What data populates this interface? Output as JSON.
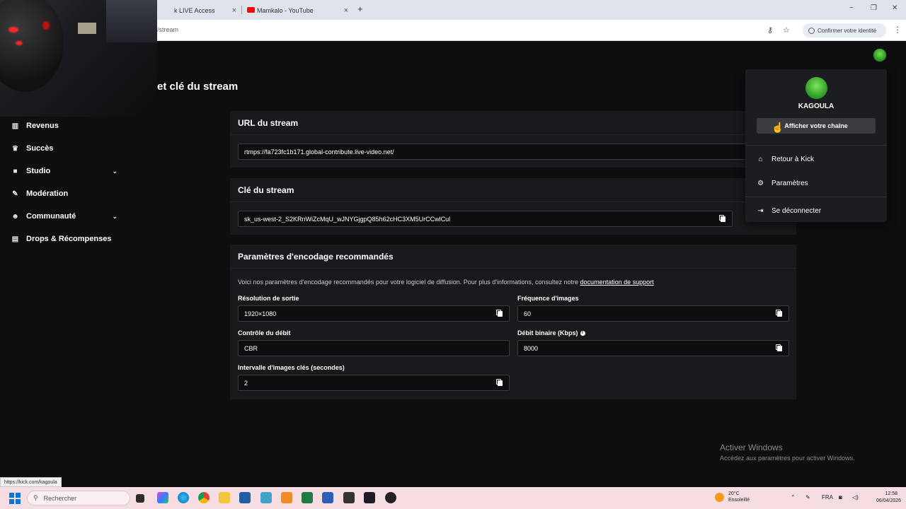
{
  "browser": {
    "tabs": [
      {
        "title": "k LIVE Access",
        "close": "×"
      },
      {
        "title": "Mamkalo - YouTube",
        "close": "×"
      }
    ],
    "new_tab": "+",
    "url": "/stream",
    "confirm_identity": "Confirmer votre identité",
    "window_min": "−",
    "window_max": "❐",
    "window_close": "✕"
  },
  "sidebar": {
    "items": [
      {
        "label": "Revenus",
        "icon": "bar-chart-icon",
        "glyph": "▥"
      },
      {
        "label": "Succès",
        "icon": "trophy-icon",
        "glyph": "🏆"
      },
      {
        "label": "Studio",
        "icon": "video-icon",
        "glyph": "■",
        "chevron": "⌄"
      },
      {
        "label": "Modération",
        "icon": "wrench-icon",
        "glyph": "🔧"
      },
      {
        "label": "Communauté",
        "icon": "users-icon",
        "glyph": "👥",
        "chevron": "⌄"
      },
      {
        "label": "Drops & Récompenses",
        "icon": "gift-icon",
        "glyph": "▤"
      }
    ]
  },
  "page": {
    "title": "et clé du stream"
  },
  "stream_url": {
    "heading": "URL du stream",
    "value": "rtmps://fa723fc1b171.global-contribute.live-video.net/"
  },
  "stream_key": {
    "heading": "Clé du stream",
    "value": "sk_us-west-2_S2KRnWiZcMqU_wJNYGjgpQ85h62cHC3XM5UrCCwlCul"
  },
  "encoding": {
    "heading": "Paramètres d'encodage recommandés",
    "description": "Voici nos paramètres d'encodage recommandés pour votre logiciel de diffusion. Pour plus d'informations, consultez notre ",
    "link": "documentation de support",
    "fields": {
      "resolution": {
        "label": "Résolution de sortie",
        "value": "1920×1080"
      },
      "framerate": {
        "label": "Fréquence d'images",
        "value": "60"
      },
      "rate_control": {
        "label": "Contrôle du débit",
        "value": "CBR"
      },
      "bitrate": {
        "label": "Débit binaire (Kbps)",
        "value": "8000"
      },
      "keyframe": {
        "label": "Intervalle d'images clés (secondes)",
        "value": "2"
      }
    }
  },
  "profile_menu": {
    "username": "KAGOULA",
    "view_channel": "Afficher votre chaîne",
    "items": [
      {
        "label": "Retour à Kick",
        "icon": "home-icon",
        "glyph": "⌂"
      },
      {
        "label": "Paramètres",
        "icon": "gear-icon",
        "glyph": "⚙"
      },
      {
        "label": "Se déconnecter",
        "icon": "logout-icon",
        "glyph": "⇥"
      }
    ]
  },
  "watermark": {
    "title": "Activer Windows",
    "subtitle": "Accédez aux paramètres pour activer Windows."
  },
  "status_link": "https://kick.com/kagoula",
  "taskbar": {
    "search_placeholder": "Rechercher",
    "weather_temp": "20°C",
    "weather_desc": "Ensoleillé",
    "lang": "FRA",
    "time": "12:58",
    "date": "06/04/2026"
  }
}
